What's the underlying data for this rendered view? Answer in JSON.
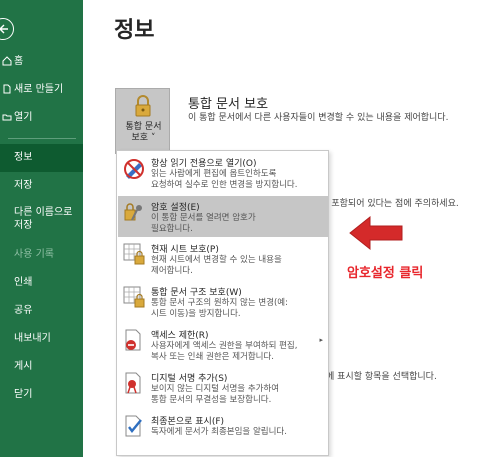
{
  "sidebar": {
    "items": [
      {
        "label": "홈"
      },
      {
        "label": "새로 만들기"
      },
      {
        "label": "열기"
      },
      {
        "label": "정보"
      },
      {
        "label": "저장"
      },
      {
        "label": "다른 이름으로 저장"
      },
      {
        "label": "사용 기록"
      },
      {
        "label": "인쇄"
      },
      {
        "label": "공유"
      },
      {
        "label": "내보내기"
      },
      {
        "label": "게시"
      },
      {
        "label": "닫기"
      }
    ],
    "save_as_line1": "다른 이름으로",
    "save_as_line2": "저장"
  },
  "main": {
    "title": "정보",
    "protect_button_line1": "통합 문서",
    "protect_button_line2": "보호 ˅",
    "section_title": "통합 문서 보호",
    "section_desc": "이 통합 문서에서 다른 사용자들이 변경할 수 있는 내용을 제어합니다.",
    "bg_text_1": "l 포함되어 있다는 점에 주의하세요.",
    "bg_text_2": "에 표시할 항목을 선택합니다."
  },
  "menu": {
    "items": [
      {
        "title": "항상 읽기 전용으로 열기(O)",
        "desc1": "읽는 사람에게 편집에 옵트인하도록",
        "desc2": "요청하여 실수로 인한 변경을 방지합니다."
      },
      {
        "title": "암호 설정(E)",
        "desc1": "이 통합 문서를 열려면 암호가",
        "desc2": "필요합니다."
      },
      {
        "title": "현재 시트 보호(P)",
        "desc1": "현재 시트에서 변경할 수 있는 내용을",
        "desc2": "제어합니다."
      },
      {
        "title": "통합 문서 구조 보호(W)",
        "desc1": "통합 문서 구조의 원하지 않는 변경(예:",
        "desc2": "시트 이동)을 방지합니다."
      },
      {
        "title": "액세스 제한(R)",
        "desc1": "사용자에게 액세스 권한을 부여하되 편집,",
        "desc2": "복사 또는 인쇄 권한은 제거합니다."
      },
      {
        "title": "디지털 서명 추가(S)",
        "desc1": "보이지 않는 디지털 서명을 추가하여",
        "desc2": "통합 문서의 무결성을 보장합니다."
      },
      {
        "title": "최종본으로 표시(F)",
        "desc1": "독자에게 문서가 최종본임을 알립니다.",
        "desc2": ""
      }
    ],
    "submenu_arrow": "▸"
  },
  "annotation": {
    "label": "암호설정 클릭"
  },
  "colors": {
    "sidebar": "#217346",
    "sidebar_active": "#0e5b30",
    "highlight": "#c6c6c6",
    "annotation": "#e8262c"
  }
}
